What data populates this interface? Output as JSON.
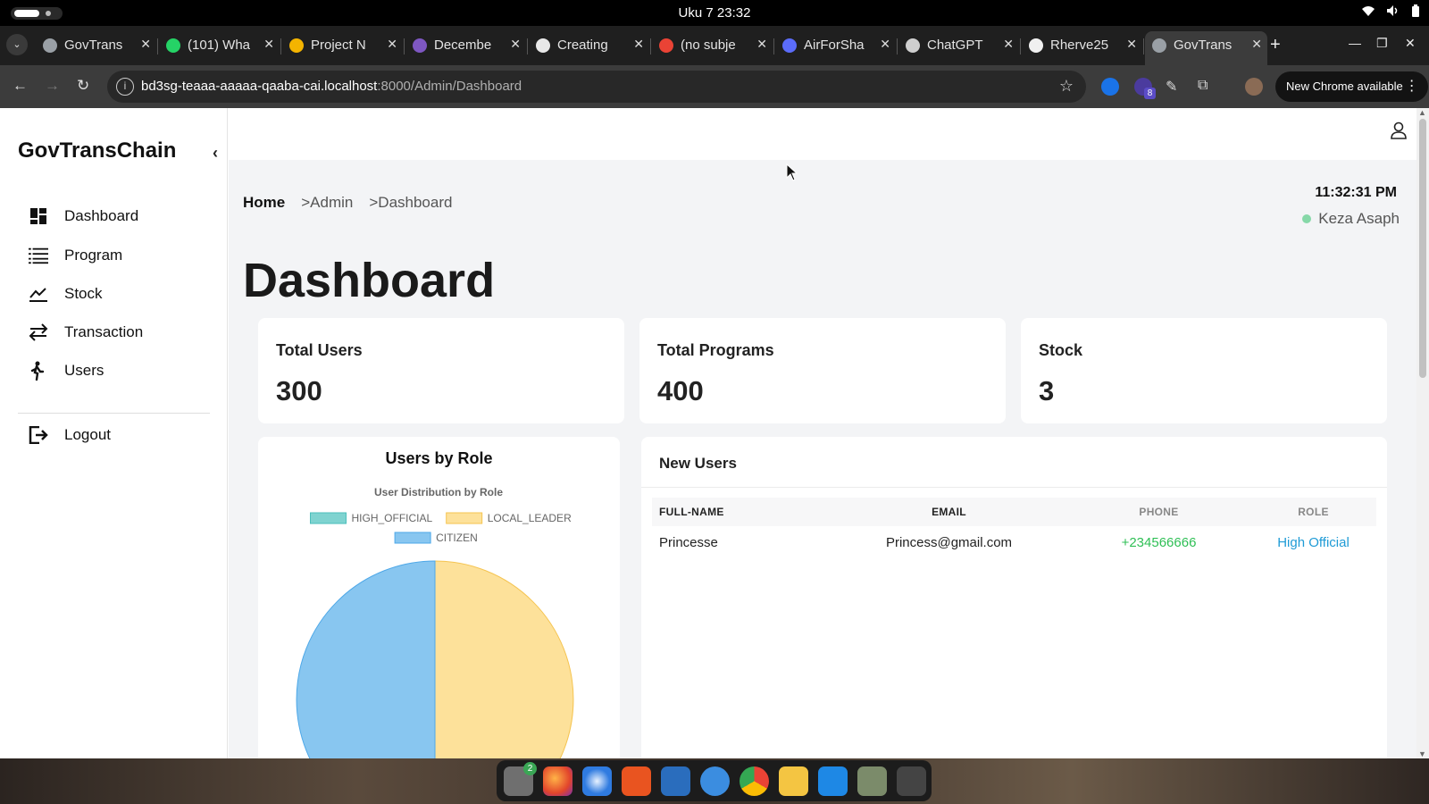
{
  "os": {
    "clock": "Uku 7  23:32"
  },
  "browser": {
    "tabs": [
      {
        "title": "GovTrans",
        "icon_color": "#9aa0a6"
      },
      {
        "title": "(101) Wha",
        "icon_color": "#25d366"
      },
      {
        "title": "Project N",
        "icon_color": "#f4b400"
      },
      {
        "title": "Decembe",
        "icon_color": "#7e57c2"
      },
      {
        "title": "Creating",
        "icon_color": "#e8e8e8"
      },
      {
        "title": "(no subje",
        "icon_color": "#ea4335"
      },
      {
        "title": "AirForSha",
        "icon_color": "#5b6cf9"
      },
      {
        "title": "ChatGPT",
        "icon_color": "#cfcfcf"
      },
      {
        "title": "Rherve25",
        "icon_color": "#f0f0f0"
      },
      {
        "title": "GovTrans",
        "icon_color": "#9aa0a6"
      }
    ],
    "url_host": "bd3sg-teaaa-aaaaa-qaaba-cai.localhost",
    "url_rest": ":8000/Admin/Dashboard",
    "extension_badge": "8",
    "update_label": "New Chrome available"
  },
  "app": {
    "brand": "GovTransChain",
    "nav": [
      {
        "label": "Dashboard",
        "icon": "dashboard-icon"
      },
      {
        "label": "Program",
        "icon": "list-icon"
      },
      {
        "label": "Stock",
        "icon": "trend-chart-icon"
      },
      {
        "label": "Transaction",
        "icon": "swap-arrows-icon"
      },
      {
        "label": "Users",
        "icon": "person-walking-icon"
      }
    ],
    "logout_label": "Logout"
  },
  "breadcrumb": {
    "home": "Home",
    "items": [
      ">Admin",
      ">Dashboard"
    ]
  },
  "header": {
    "time": "11:32:31 PM",
    "user_name": "Keza Asaph",
    "status_color": "#86d8a8"
  },
  "page_title": "Dashboard",
  "stats": [
    {
      "label": "Total Users",
      "value": "300"
    },
    {
      "label": "Total Programs",
      "value": "400"
    },
    {
      "label": "Stock",
      "value": "3"
    }
  ],
  "chart_card_title": "Users by Role",
  "chart_data": {
    "type": "pie",
    "title": "User Distribution by Role",
    "legend": [
      {
        "name": "HIGH_OFFICIAL",
        "color": "#7fd3d0",
        "value": 0
      },
      {
        "name": "LOCAL_LEADER",
        "color": "#fde19a",
        "value": 1
      },
      {
        "name": "CITIZEN",
        "color": "#88c6f0",
        "value": 1
      }
    ],
    "legend_position": "top"
  },
  "new_users": {
    "title": "New Users",
    "columns": [
      "FULL-NAME",
      "EMAIL",
      "PHONE",
      "ROLE"
    ],
    "rows": [
      {
        "name": "Princesse",
        "email": "Princess@gmail.com",
        "phone": "+234566666",
        "role": "High Official"
      }
    ]
  },
  "dock": {
    "files_badge": "2"
  }
}
